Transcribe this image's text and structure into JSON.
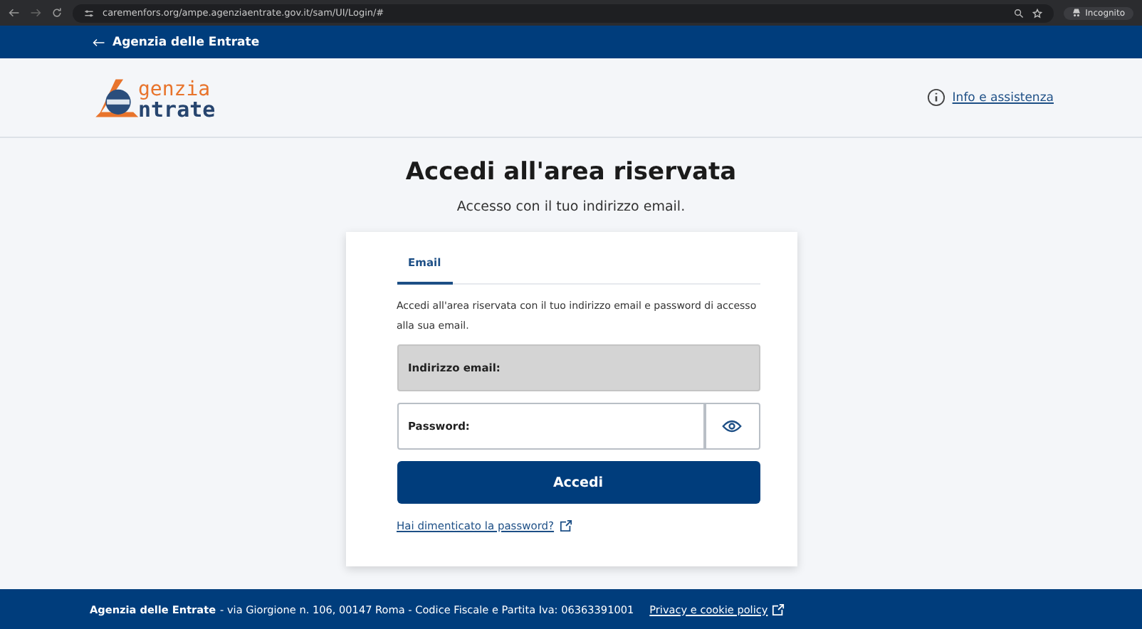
{
  "browser": {
    "url": "caremenfors.org/ampe.agenziaentrate.gov.it/sam/UI/Login/#",
    "profile": "Incognito"
  },
  "top_bar": {
    "back_link": "Agenzia delle Entrate"
  },
  "header": {
    "logo": {
      "line1": "genzia",
      "line2": "ntrate"
    },
    "help_link": "Info e assistenza"
  },
  "title": "Accedi all'area riservata",
  "subtitle": "Accesso con il tuo indirizzo email.",
  "login_card": {
    "tabs": [
      {
        "label": "Email",
        "selected": true
      }
    ],
    "intro": "Accedi all'area riservata con il tuo indirizzo email e password di accesso alla sua email.",
    "fields": [
      {
        "kind": "text",
        "placeholder": "Indirizzo email:",
        "disabled": true
      },
      {
        "kind": "password",
        "placeholder": "Password:",
        "disabled": false
      }
    ],
    "submit": "Accedi",
    "forgot_link": "Hai dimenticato la password?"
  },
  "footer": {
    "name": "Agenzia delle Entrate",
    "address": "- via Giorgione n. 106, 00147 Roma - Codice Fiscale e Partita Iva: 06363391001",
    "privacy_link": "Privacy e cookie policy"
  }
}
